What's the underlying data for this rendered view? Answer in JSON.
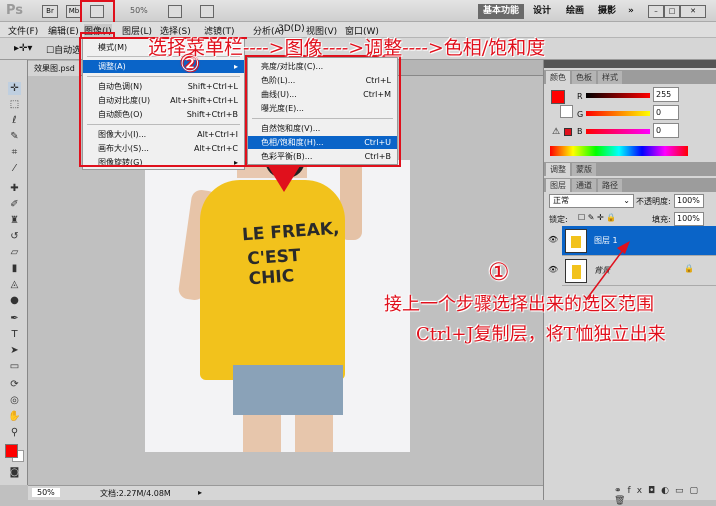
{
  "titlebar": {
    "logo": "Ps",
    "br": "Br",
    "mb": "Mb",
    "zoom": "50%",
    "workspaces": [
      "基本功能",
      "设计",
      "绘画",
      "摄影"
    ],
    "more": "»"
  },
  "menubar": [
    "文件(F)",
    "编辑(E)",
    "图像(I)",
    "图层(L)",
    "选择(S)",
    "滤镜(T)",
    "分析(A)",
    "3D(D)",
    "视图(V)",
    "窗口(W)"
  ],
  "options": {
    "auto_select": "自动选"
  },
  "document": {
    "tab": "效果图.psd"
  },
  "image_menu": {
    "items": [
      {
        "label": "模式(M)",
        "shortcut": ""
      },
      {
        "label": "调整(A)",
        "shortcut": "",
        "highlight": true
      },
      {
        "label": "自动色调(N)",
        "shortcut": "Shift+Ctrl+L"
      },
      {
        "label": "自动对比度(U)",
        "shortcut": "Alt+Shift+Ctrl+L"
      },
      {
        "label": "自动颜色(O)",
        "shortcut": "Shift+Ctrl+B"
      },
      {
        "label": "图像大小(I)...",
        "shortcut": "Alt+Ctrl+I"
      },
      {
        "label": "画布大小(S)...",
        "shortcut": "Alt+Ctrl+C"
      },
      {
        "label": "图像旋转(G)",
        "shortcut": ""
      }
    ]
  },
  "adjust_submenu": {
    "items": [
      {
        "label": "亮度/对比度(C)...",
        "shortcut": ""
      },
      {
        "label": "色阶(L)...",
        "shortcut": "Ctrl+L"
      },
      {
        "label": "曲线(U)...",
        "shortcut": "Ctrl+M"
      },
      {
        "label": "曝光度(E)...",
        "shortcut": ""
      },
      {
        "label": "自然饱和度(V)...",
        "shortcut": ""
      },
      {
        "label": "色相/饱和度(H)...",
        "shortcut": "Ctrl+U",
        "highlight": true
      },
      {
        "label": "色彩平衡(B)...",
        "shortcut": "Ctrl+B"
      }
    ]
  },
  "annotations": {
    "top": "选择菜单栏---->图像---->调整---->色相/饱和度",
    "step2": "②",
    "step1": "①",
    "line1": "接上一个步骤选择出来的选区范围",
    "line2": "Ctrl+J复制层，将T恤独立出来"
  },
  "photo": {
    "shirt_line1": "LE FREAK,",
    "shirt_line2": "C'EST CHIC"
  },
  "color_panel": {
    "tabs": [
      "颜色",
      "色板",
      "样式"
    ],
    "r_label": "R",
    "g_label": "G",
    "b_label": "B",
    "r": "255",
    "g": "0",
    "b": "0",
    "foreground": "#ff0000",
    "background": "#ffffff"
  },
  "adjust_panel": {
    "tabs": [
      "调整",
      "蒙版"
    ]
  },
  "layers_panel": {
    "tabs": [
      "图层",
      "通道",
      "路径"
    ],
    "blend": "正常",
    "opacity_label": "不透明度:",
    "opacity": "100%",
    "lock_label": "锁定:",
    "fill_label": "填充:",
    "fill": "100%",
    "layers": [
      {
        "name": "图层 1",
        "selected": true
      },
      {
        "name": "背景",
        "locked": true
      }
    ]
  },
  "status": {
    "zoom": "50%",
    "doc": "文档:2.27M/4.08M"
  },
  "colors": {
    "accent": "#e0101c",
    "selection": "#0a64c8",
    "shirt": "#f2c21c"
  }
}
